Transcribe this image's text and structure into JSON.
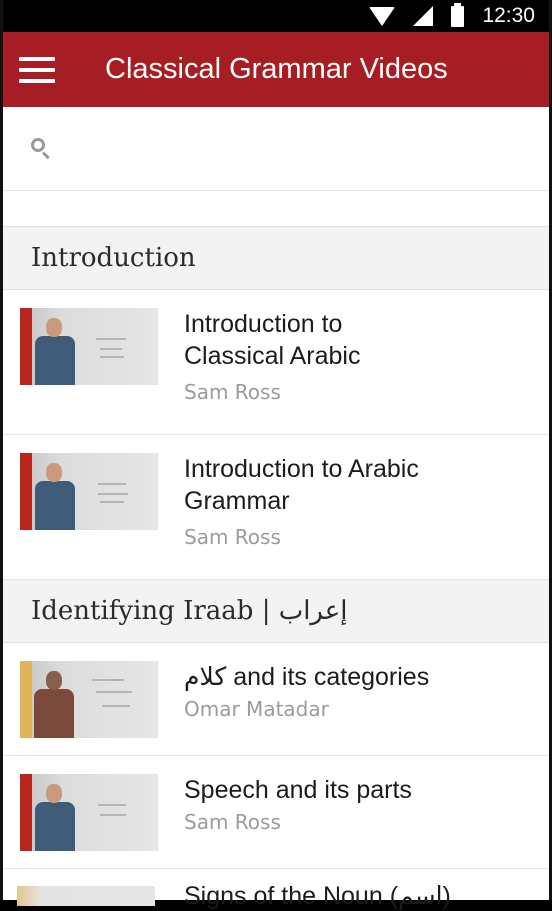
{
  "status_bar": {
    "time": "12:30"
  },
  "app_bar": {
    "title": "Classical Grammar Videos"
  },
  "search": {
    "placeholder": ""
  },
  "sections": [
    {
      "header": "Introduction",
      "items": [
        {
          "title": "Introduction to Classical Arabic",
          "author": "Sam Ross",
          "thumb_accent": "#b8261f"
        },
        {
          "title": "Introduction to Arabic Grammar",
          "author": "Sam Ross",
          "thumb_accent": "#b8261f"
        }
      ]
    },
    {
      "header": "Identifying Iraab | إعراب",
      "items": [
        {
          "title": "كلام and its categories",
          "author": "Omar Matadar",
          "thumb_accent": "#e0b45b"
        },
        {
          "title": "Speech and its parts",
          "author": "Sam Ross",
          "thumb_accent": "#b8261f"
        },
        {
          "title": "Signs of the Noun (اسم)",
          "author": "",
          "thumb_accent": "#e0b45b"
        }
      ]
    }
  ],
  "colors": {
    "app_bar": "#a61d24",
    "section_bg": "#f3f3f3",
    "author_text": "#9b9b9b"
  },
  "icons": [
    "wifi-icon",
    "signal-icon",
    "battery-icon",
    "menu-icon",
    "search-icon"
  ]
}
